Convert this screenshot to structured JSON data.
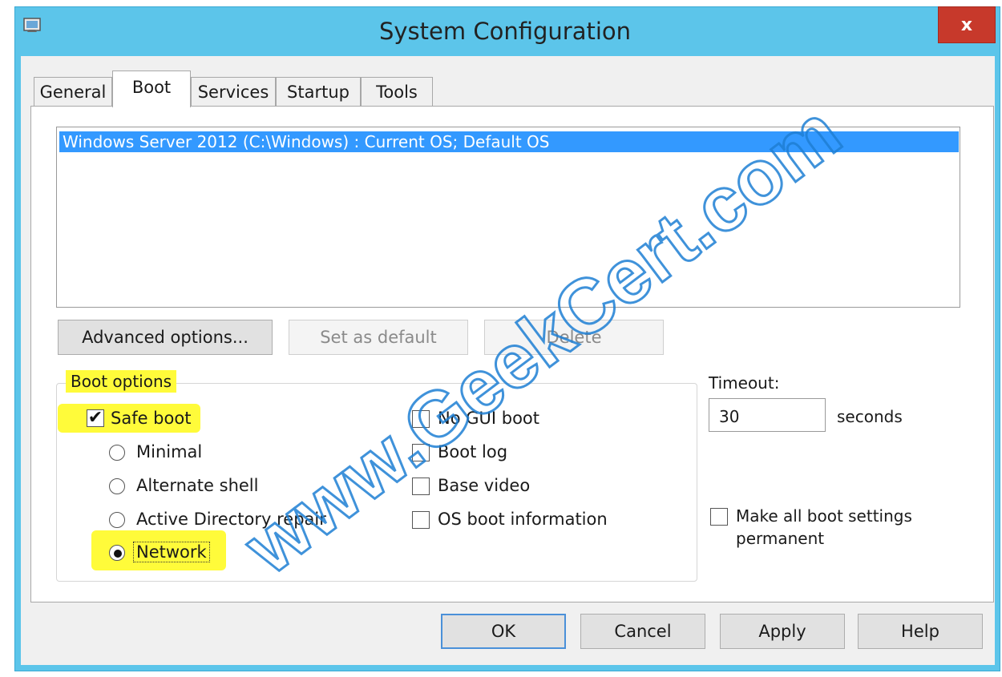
{
  "window": {
    "title": "System Configuration",
    "close_glyph": "x"
  },
  "tabs": [
    {
      "label": "General",
      "active": false
    },
    {
      "label": "Boot",
      "active": true
    },
    {
      "label": "Services",
      "active": false
    },
    {
      "label": "Startup",
      "active": false
    },
    {
      "label": "Tools",
      "active": false
    }
  ],
  "os_list": {
    "items": [
      "Windows Server 2012 (C:\\Windows) : Current OS; Default OS"
    ],
    "selected_index": 0
  },
  "boot_buttons": {
    "advanced": "Advanced options...",
    "set_default": "Set as default",
    "delete": "Delete"
  },
  "boot_options": {
    "group_label": "Boot options",
    "safe_boot": {
      "label": "Safe boot",
      "checked": true
    },
    "safe_boot_modes": [
      {
        "label": "Minimal",
        "selected": false
      },
      {
        "label": "Alternate shell",
        "selected": false
      },
      {
        "label": "Active Directory repair",
        "selected": false
      },
      {
        "label": "Network",
        "selected": true
      }
    ],
    "checkboxes": [
      {
        "label": "No GUI boot",
        "checked": false
      },
      {
        "label": "Boot log",
        "checked": false
      },
      {
        "label": "Base video",
        "checked": false
      },
      {
        "label": "OS boot information",
        "checked": false
      }
    ]
  },
  "timeout": {
    "label": "Timeout:",
    "value": "30",
    "unit": "seconds"
  },
  "permanent": {
    "label_line1": "Make all boot settings",
    "label_line2": "permanent",
    "checked": false
  },
  "dialog_buttons": {
    "ok": "OK",
    "cancel": "Cancel",
    "apply": "Apply",
    "help": "Help"
  },
  "watermark": "www.GeekCert.com",
  "colors": {
    "title_bar": "#5cc5ea",
    "close_button": "#c7392b",
    "selection": "#3399ff",
    "highlight": "#fffb3a",
    "watermark_stroke": "#1e7fd4"
  },
  "icons": {
    "app": "system-config-icon",
    "close": "close-icon",
    "check": "checkmark-icon"
  }
}
